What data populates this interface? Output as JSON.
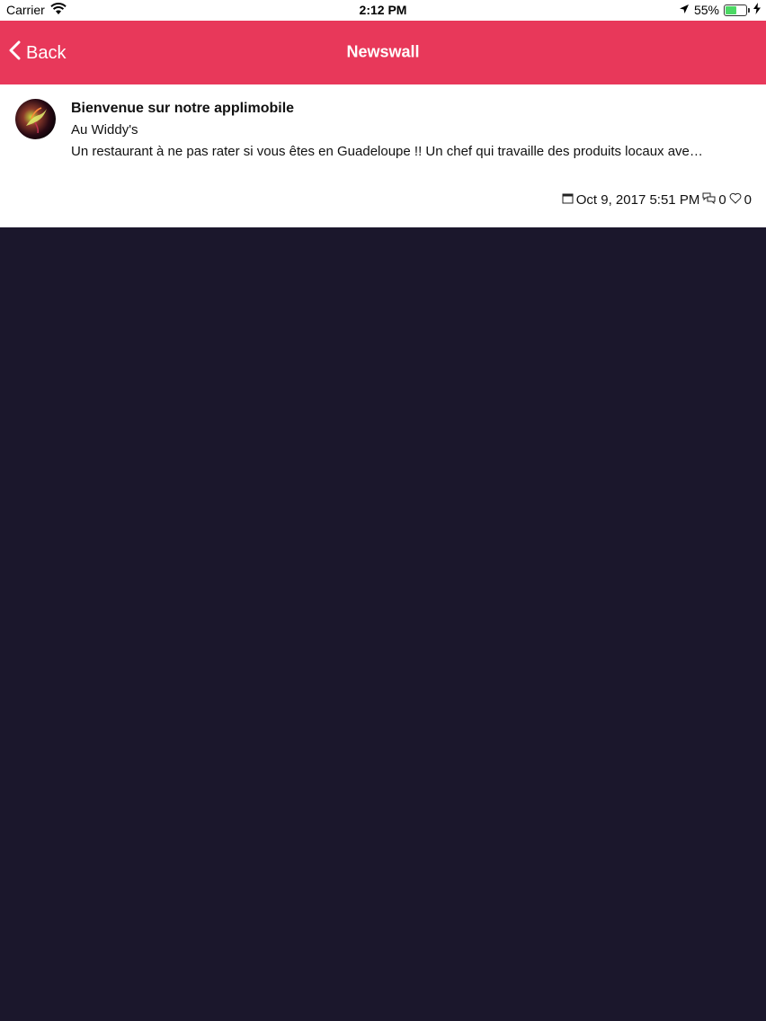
{
  "status_bar": {
    "carrier": "Carrier",
    "time": "2:12 PM",
    "battery_percent": "55%",
    "battery_level": 0.55,
    "icons": [
      "wifi-icon",
      "location-arrow-icon",
      "battery-icon",
      "charging-bolt-icon"
    ]
  },
  "navbar": {
    "back_label": "Back",
    "title": "Newswall",
    "color": "#e8385a"
  },
  "feed": {
    "items": [
      {
        "title": "Bienvenue sur notre applimobile",
        "author": "Au Widdy's",
        "excerpt": "Un restaurant à ne pas rater si vous êtes en Guadeloupe !! Un chef qui travaille des produits locaux ave…",
        "date": "Oct 9, 2017 5:51 PM",
        "comments": "0",
        "likes": "0"
      }
    ]
  },
  "colors": {
    "background": "#1b172c",
    "card": "#ffffff"
  }
}
